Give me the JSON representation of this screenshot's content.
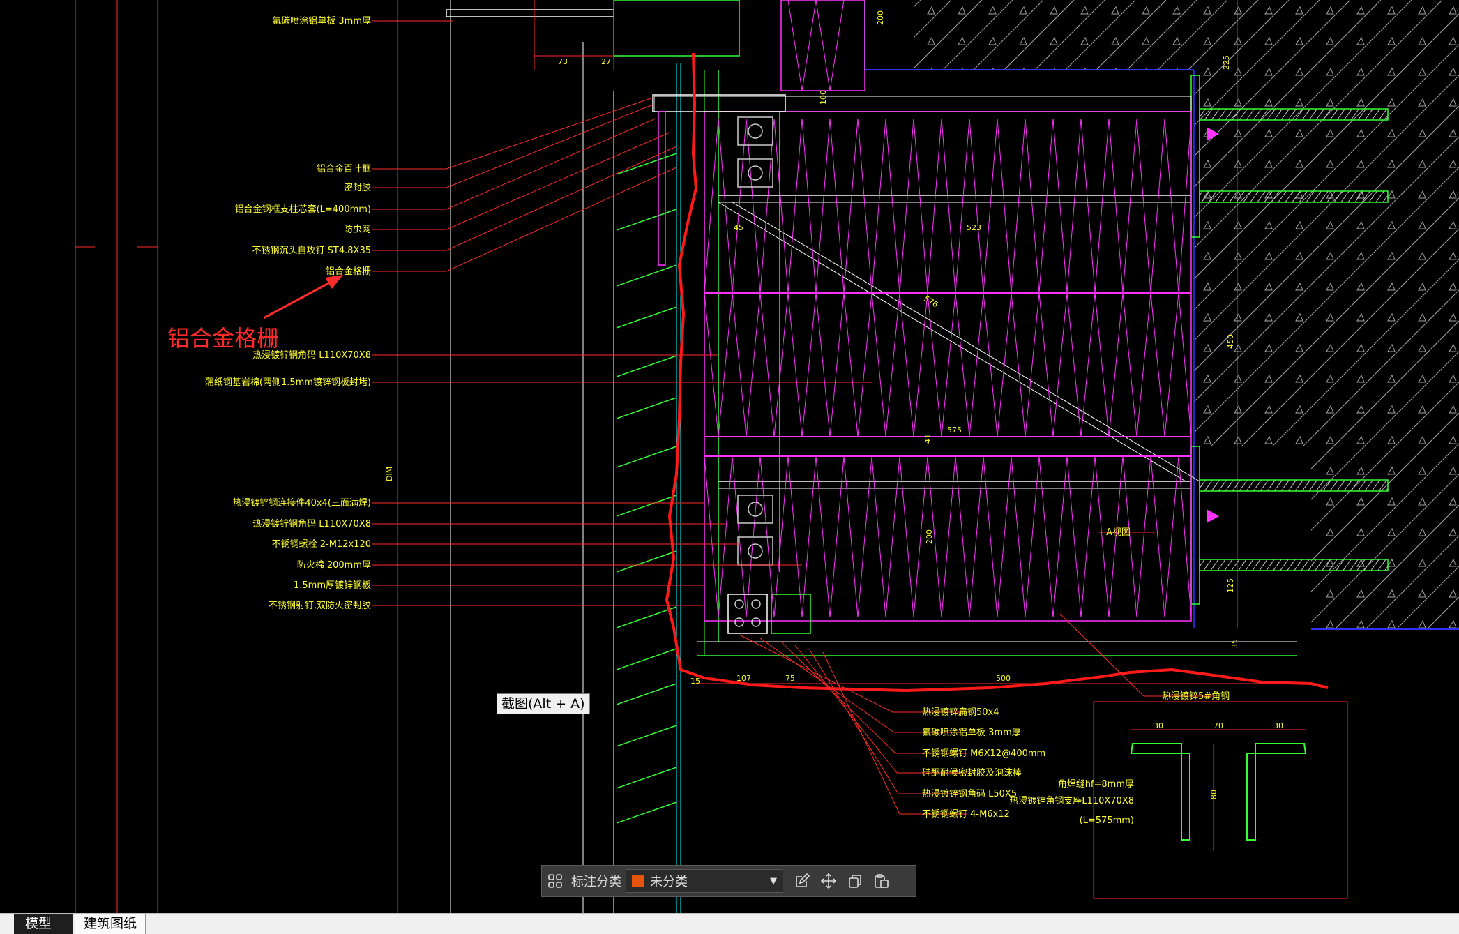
{
  "drawing": {
    "labels_left": [
      "氟碳喷涂铝单板 3mm厚",
      "铝合金百叶框",
      "密封胶",
      "铝合金钢框支柱芯套(L=400mm)",
      "防虫网",
      "不锈钢沉头自攻钉 ST4.8X35",
      "铝合金格栅",
      "热浸镀锌钢角码 L110X70X8",
      "蒲纸钢基岩棉(两侧1.5mm镀锌钢板封堵)",
      "热浸镀锌钢连接件40x4(三面满焊)",
      "热浸镀锌钢角码 L110X70X8",
      "不锈钢螺栓 2-M12x120",
      "防火棉 200mm厚",
      "1.5mm厚镀锌钢板",
      "不锈钢射钉,双防火密封胶"
    ],
    "labels_bottom": [
      "热浸镀锌扁钢50x4",
      "氟碳喷涂铝单板 3mm厚",
      "不锈钢螺钉 M6X12@400mm",
      "硅酮耐候密封胶及泡沫棒",
      "热浸镀锌钢角码 L50X5",
      "不锈钢螺钉 4-M6x12"
    ],
    "annotation": "铝合金格栅",
    "label_a_view": "A视图",
    "label_weld": "热浸镀锌5#角钢",
    "detail_labels": [
      "角焊缝hf=8mm厚",
      "热浸镀锌角钢支座L110X70X8",
      "(L=575mm)"
    ],
    "dimensions": {
      "d73": "73",
      "d27": "27",
      "d200": "200",
      "d100": "100",
      "d45": "45",
      "d523": "523",
      "d576": "576",
      "d575": "575",
      "d200b": "200",
      "d107": "107",
      "d75": "75",
      "d500": "500",
      "d225": "225",
      "d450": "450",
      "d125": "125",
      "d30a": "30",
      "d70": "70",
      "d30b": "30",
      "d80": "80",
      "d15": "15",
      "d35": "35",
      "dval": "DIM",
      "d41": "41"
    }
  },
  "tooltip": "截图(Alt + A)",
  "toolbar": {
    "label": "标注分类",
    "selected": "未分类",
    "swatch_color": "#e8540c",
    "icons": [
      "grid-icon",
      "edit-icon",
      "move-icon",
      "copy-icon",
      "paste-icon"
    ]
  },
  "tabs": [
    "模型",
    "建筑图纸"
  ],
  "colors": {
    "background": "#000000",
    "text": "#ffff33",
    "leader": "#ff2a2a",
    "insulation": "#ff33ff",
    "steel": "#33ff33",
    "frame": "#ffffff",
    "struct": "#00ffff",
    "slab": "#3333ff"
  }
}
